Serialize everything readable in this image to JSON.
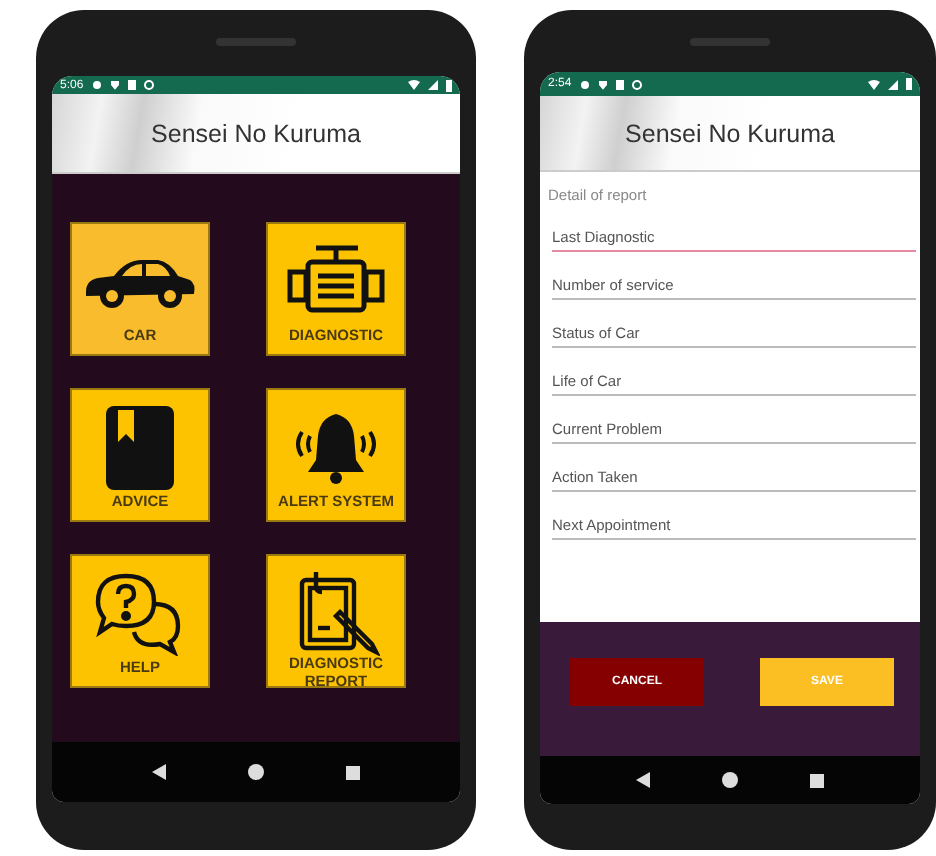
{
  "phones": [
    {
      "kind": "menu",
      "status_bar": {
        "time": "5:06"
      },
      "app_bar": {
        "title": "Sensei No Kuruma"
      },
      "tiles": [
        {
          "label": "CAR"
        },
        {
          "label": "DIAGNOSTIC"
        },
        {
          "label": "ADVICE"
        },
        {
          "label": "ALERT SYSTEM"
        },
        {
          "label": "HELP"
        },
        {
          "label": "DIAGNOSTIC REPORT"
        }
      ]
    },
    {
      "kind": "form",
      "status_bar": {
        "time": "2:54"
      },
      "app_bar": {
        "title": "Sensei No Kuruma"
      },
      "section_label": "Detail of report",
      "fields": [
        {
          "placeholder": "Last Diagnostic",
          "focused": true
        },
        {
          "placeholder": "Number of service",
          "focused": false
        },
        {
          "placeholder": "Status of Car",
          "focused": false
        },
        {
          "placeholder": "Life of Car",
          "focused": false
        },
        {
          "placeholder": "Current Problem",
          "focused": false
        },
        {
          "placeholder": "Action Taken",
          "focused": false
        },
        {
          "placeholder": "Next Appointment",
          "focused": false
        }
      ],
      "buttons": [
        {
          "label": "CANCEL",
          "kind": "cancel"
        },
        {
          "label": "SAVE",
          "kind": "save"
        }
      ]
    }
  ]
}
